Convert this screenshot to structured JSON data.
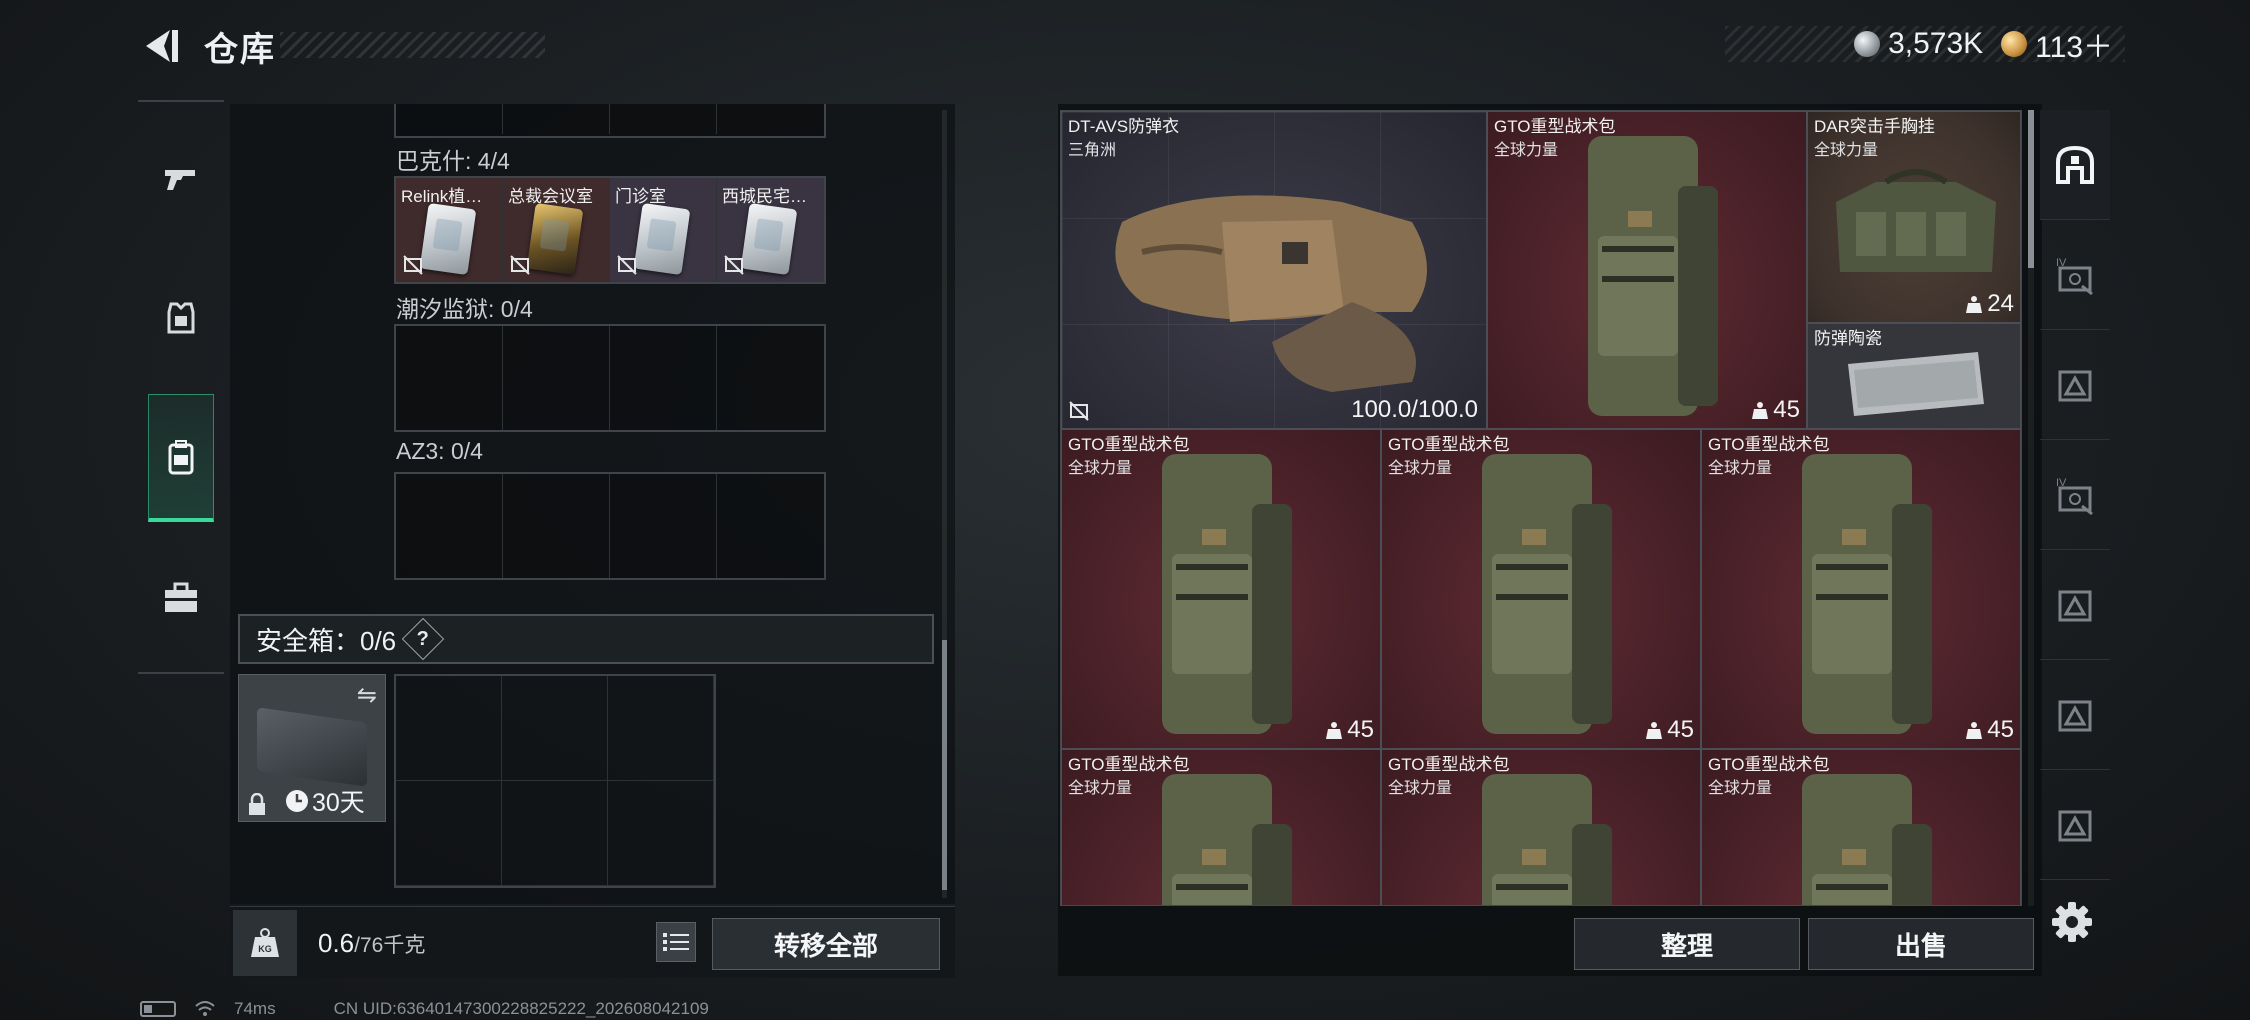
{
  "header": {
    "title": "仓库",
    "currencies": [
      {
        "icon": "silver-coin-icon",
        "value": "3,573K"
      },
      {
        "icon": "gold-coin-icon",
        "value": "113＋"
      }
    ]
  },
  "left_nav": {
    "items": [
      {
        "icon": "pistol-icon",
        "active": false
      },
      {
        "icon": "armor-vest-icon",
        "active": false
      },
      {
        "icon": "backpack-icon",
        "active": true
      },
      {
        "icon": "toolbox-icon",
        "active": false
      }
    ]
  },
  "containers": {
    "bakshi": {
      "label": "巴克什: 4/4",
      "cards": [
        {
          "name": "Relink植…",
          "style": "silver"
        },
        {
          "name": "总裁会议室",
          "style": "gold"
        },
        {
          "name": "门诊室",
          "style": "silver"
        },
        {
          "name": "西城民宅…",
          "style": "silver"
        }
      ]
    },
    "tide_prison": {
      "label": "潮汐监狱: 0/4"
    },
    "az3": {
      "label": "AZ3: 0/4"
    }
  },
  "safe_box": {
    "title": "安全箱：0/6",
    "help": "?",
    "duration": "30天"
  },
  "weight": {
    "current": "0.6",
    "capacity": "/76千克",
    "icon_label": "KG"
  },
  "buttons": {
    "transfer_all": "转移全部",
    "sort": "整理",
    "sell": "出售"
  },
  "stash_items": [
    {
      "name": "DT-AVS防弹衣",
      "sub": "三角洲",
      "durability": "100.0/100.0"
    },
    {
      "name": "GTO重型战术包",
      "sub": "全球力量",
      "count": "45"
    },
    {
      "name": "DAR突击手胸挂",
      "sub": "全球力量",
      "count": "24"
    },
    {
      "name": "防弹陶瓷",
      "sub": ""
    },
    {
      "name": "GTO重型战术包",
      "sub": "全球力量",
      "count": "45"
    },
    {
      "name": "GTO重型战术包",
      "sub": "全球力量",
      "count": "45"
    },
    {
      "name": "GTO重型战术包",
      "sub": "全球力量",
      "count": "45"
    },
    {
      "name": "GTO重型战术包",
      "sub": "全球力量"
    },
    {
      "name": "GTO重型战术包",
      "sub": "全球力量"
    },
    {
      "name": "GTO重型战术包",
      "sub": "全球力量"
    }
  ],
  "right_tabs": [
    {
      "icon": "home-base-icon",
      "active": true
    },
    {
      "icon": "backpack-tier-iv-icon"
    },
    {
      "icon": "container-tier-icon"
    },
    {
      "icon": "backpack-tier-iv-icon"
    },
    {
      "icon": "container-tier-icon"
    },
    {
      "icon": "container-tier-icon"
    },
    {
      "icon": "container-tier-icon"
    }
  ],
  "status": {
    "ping": "74ms",
    "uid": "CN UID:63640147300228825222_202608042109"
  }
}
